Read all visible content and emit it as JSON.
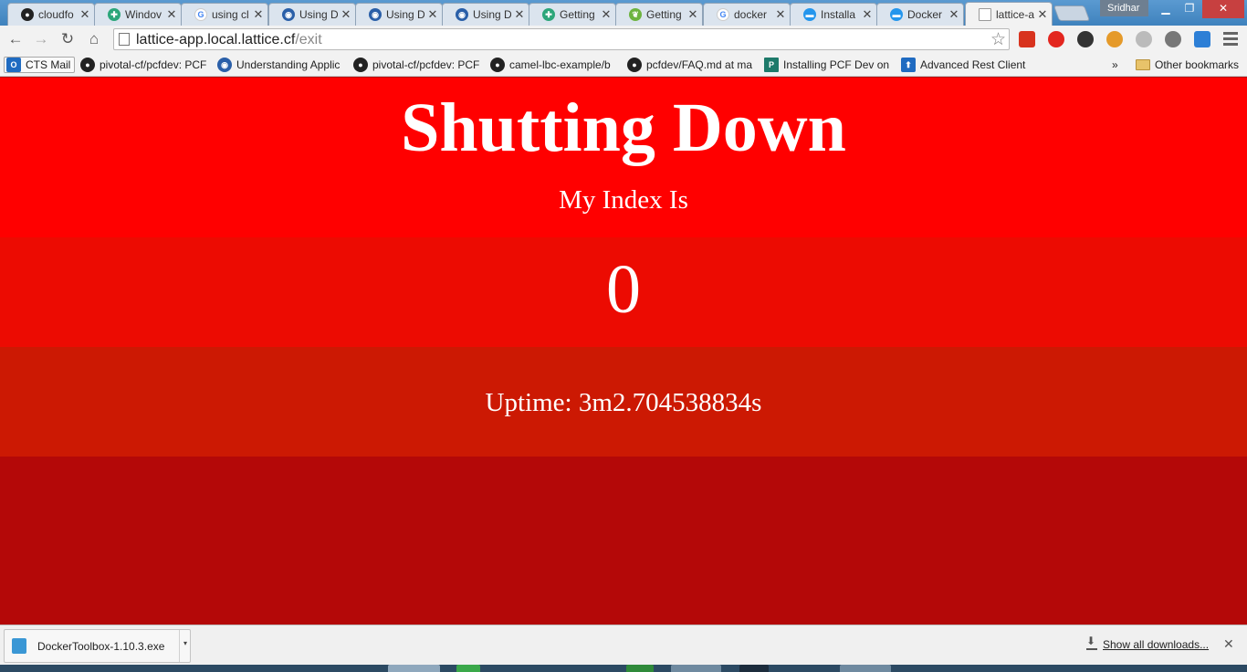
{
  "browser": {
    "tabs": [
      {
        "title": "cloudfo",
        "icon": "github-icon",
        "color": "#222222"
      },
      {
        "title": "Windov",
        "icon": "puzzle-icon",
        "color": "#2ca67a"
      },
      {
        "title": "using cl",
        "icon": "google-icon",
        "color": "#4285f4"
      },
      {
        "title": "Using D",
        "icon": "pivotal-icon",
        "color": "#2a5fa8"
      },
      {
        "title": "Using D",
        "icon": "pivotal-icon",
        "color": "#2a5fa8"
      },
      {
        "title": "Using D",
        "icon": "pivotal-icon",
        "color": "#2a5fa8"
      },
      {
        "title": "Getting",
        "icon": "puzzle-icon",
        "color": "#2ca67a"
      },
      {
        "title": "Getting",
        "icon": "spring-icon",
        "color": "#6db33f"
      },
      {
        "title": "docker",
        "icon": "google-icon",
        "color": "#4285f4"
      },
      {
        "title": "Installa",
        "icon": "docker-icon",
        "color": "#2496ed"
      },
      {
        "title": "Docker",
        "icon": "docker-icon",
        "color": "#2496ed"
      },
      {
        "title": "lattice-a",
        "icon": "page-icon",
        "color": "#ffffff",
        "active": true
      }
    ],
    "user": "Sridhar",
    "url_host": "lattice-app.local.lattice.cf",
    "url_path": "/exit"
  },
  "bookmarks": {
    "items": [
      {
        "label": "CTS Mail",
        "icon": "outlook-icon"
      },
      {
        "label": "pivotal-cf/pcfdev: PCF",
        "icon": "github-icon"
      },
      {
        "label": "Understanding Applic",
        "icon": "pivotal-icon"
      },
      {
        "label": "pivotal-cf/pcfdev: PCF",
        "icon": "github-icon"
      },
      {
        "label": "camel-lbc-example/b",
        "icon": "github-icon"
      },
      {
        "label": "pcfdev/FAQ.md at ma",
        "icon": "github-icon"
      },
      {
        "label": "Installing PCF Dev on",
        "icon": "pivotal-p-icon"
      },
      {
        "label": "Advanced Rest Client",
        "icon": "arc-icon"
      }
    ],
    "overflow": "»",
    "other": "Other bookmarks"
  },
  "page": {
    "heading": "Shutting Down",
    "subheading": "My Index Is",
    "index_value": "0",
    "uptime": "Uptime: 3m2.704538834s",
    "colors": {
      "band1": "#ff0000",
      "band2": "#ec0b02",
      "band3": "#cc1903",
      "band4": "#b40808"
    }
  },
  "downloads": {
    "file": "DockerToolbox-1.10.3.exe",
    "show_all": "Show all downloads..."
  }
}
